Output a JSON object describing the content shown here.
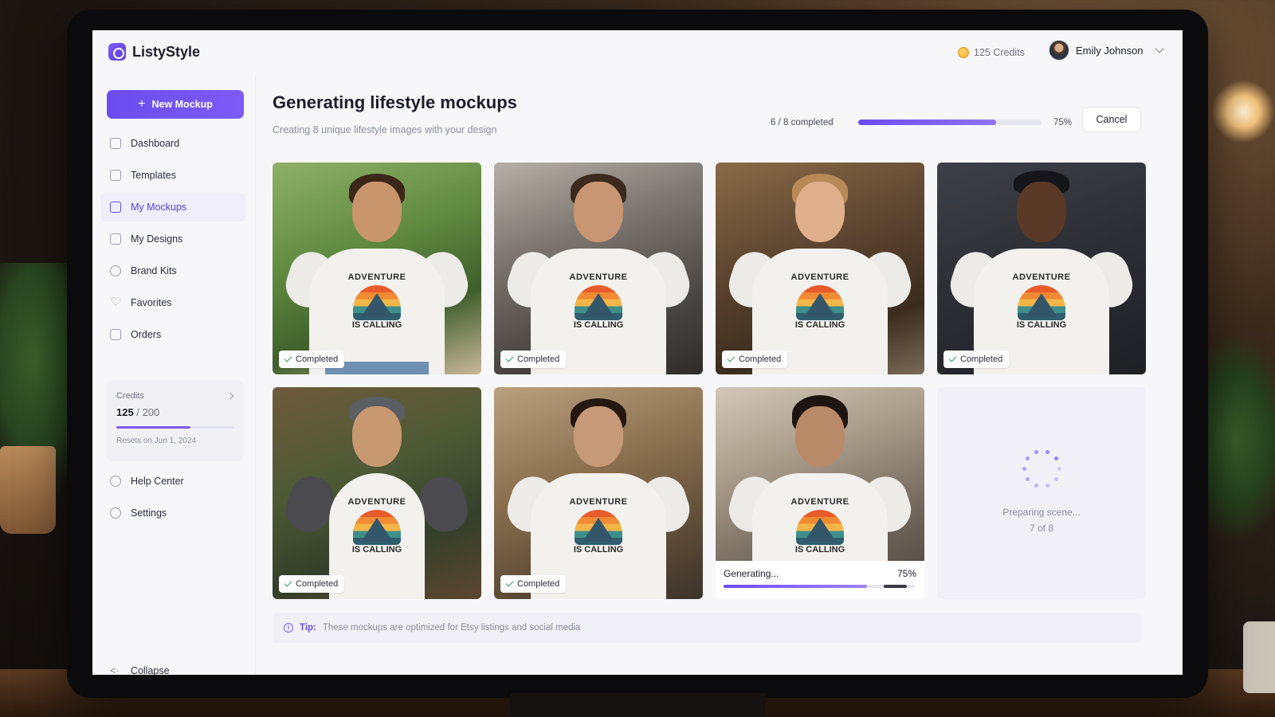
{
  "app": {
    "name": "ListyStyle"
  },
  "header": {
    "credits_label": "125 Credits",
    "user_name": "Emily Johnson"
  },
  "sidebar": {
    "new_button": "New Mockup",
    "items": [
      {
        "label": "Dashboard",
        "icon": "home-icon"
      },
      {
        "label": "Templates",
        "icon": "template-icon"
      },
      {
        "label": "My Mockups",
        "icon": "mockups-icon",
        "active": true
      },
      {
        "label": "My Designs",
        "icon": "pencil-icon"
      },
      {
        "label": "Brand Kits",
        "icon": "brand-kit-icon"
      },
      {
        "label": "Favorites",
        "icon": "heart-icon"
      },
      {
        "label": "Orders",
        "icon": "orders-icon"
      }
    ],
    "credits_card": {
      "label": "Credits",
      "used": "125",
      "separator": "/",
      "total": "200",
      "progress_fraction": 0.625,
      "reset_text": "Resets on Jun 1, 2024"
    },
    "bottom_items": [
      {
        "label": "Help Center",
        "icon": "help-icon"
      },
      {
        "label": "Settings",
        "icon": "gear-icon"
      }
    ],
    "collapse_label": "Collapse"
  },
  "main": {
    "title": "Generating lifestyle mockups",
    "subtitle": "Creating 8 unique lifestyle images with your design",
    "progress_label": "6 / 8 completed",
    "progress_percent": "75%",
    "progress_fraction": 0.75,
    "cancel_label": "Cancel",
    "cards": [
      {
        "status": "Completed"
      },
      {
        "status": "Completed"
      },
      {
        "status": "Completed"
      },
      {
        "status": "Completed"
      },
      {
        "status": "Completed"
      },
      {
        "status": "Completed"
      },
      {
        "status": "Generating...",
        "percent": "75%",
        "fraction": 0.75
      },
      {
        "status": "Preparing scene...",
        "count": "7 of 8"
      }
    ],
    "design_text_top": "ADVENTURE",
    "design_text_bottom": "IS CALLING",
    "tip_label": "Tip:",
    "tip_text": "These mockups are optimized for Etsy listings and social media"
  },
  "colors": {
    "accent": "#6a4cf0",
    "success": "#2f9e5b"
  }
}
